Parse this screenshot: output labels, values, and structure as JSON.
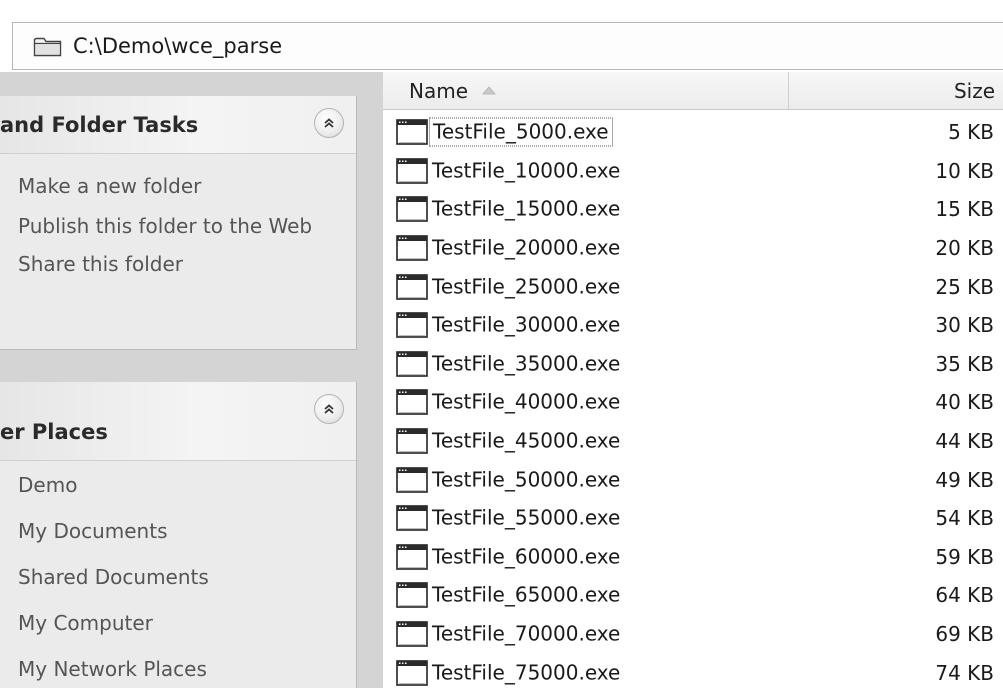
{
  "address_bar": {
    "path": "C:\\Demo\\wce_parse",
    "icon": "folder-icon"
  },
  "task_pane": {
    "folder_tasks": {
      "title": "and Folder Tasks",
      "collapse_icon": "chevron-double-up-icon",
      "links": [
        "Make a new folder",
        "Publish this folder to the Web",
        "Share this folder"
      ]
    },
    "other_places": {
      "title": "er Places",
      "collapse_icon": "chevron-double-up-icon",
      "links": [
        "Demo",
        "My Documents",
        "Shared Documents",
        "My Computer",
        "My Network Places"
      ]
    }
  },
  "file_list": {
    "columns": {
      "name": "Name",
      "size": "Size"
    },
    "sort": {
      "column": "name",
      "direction": "ascending",
      "icon": "sort-ascending-icon"
    },
    "focused_index": 0,
    "files": [
      {
        "name": "TestFile_5000.exe",
        "size": "5 KB"
      },
      {
        "name": "TestFile_10000.exe",
        "size": "10 KB"
      },
      {
        "name": "TestFile_15000.exe",
        "size": "15 KB"
      },
      {
        "name": "TestFile_20000.exe",
        "size": "20 KB"
      },
      {
        "name": "TestFile_25000.exe",
        "size": "25 KB"
      },
      {
        "name": "TestFile_30000.exe",
        "size": "30 KB"
      },
      {
        "name": "TestFile_35000.exe",
        "size": "35 KB"
      },
      {
        "name": "TestFile_40000.exe",
        "size": "40 KB"
      },
      {
        "name": "TestFile_45000.exe",
        "size": "44 KB"
      },
      {
        "name": "TestFile_50000.exe",
        "size": "49 KB"
      },
      {
        "name": "TestFile_55000.exe",
        "size": "54 KB"
      },
      {
        "name": "TestFile_60000.exe",
        "size": "59 KB"
      },
      {
        "name": "TestFile_65000.exe",
        "size": "64 KB"
      },
      {
        "name": "TestFile_70000.exe",
        "size": "69 KB"
      },
      {
        "name": "TestFile_75000.exe",
        "size": "74 KB"
      }
    ],
    "file_icon": "application-exe-icon"
  }
}
